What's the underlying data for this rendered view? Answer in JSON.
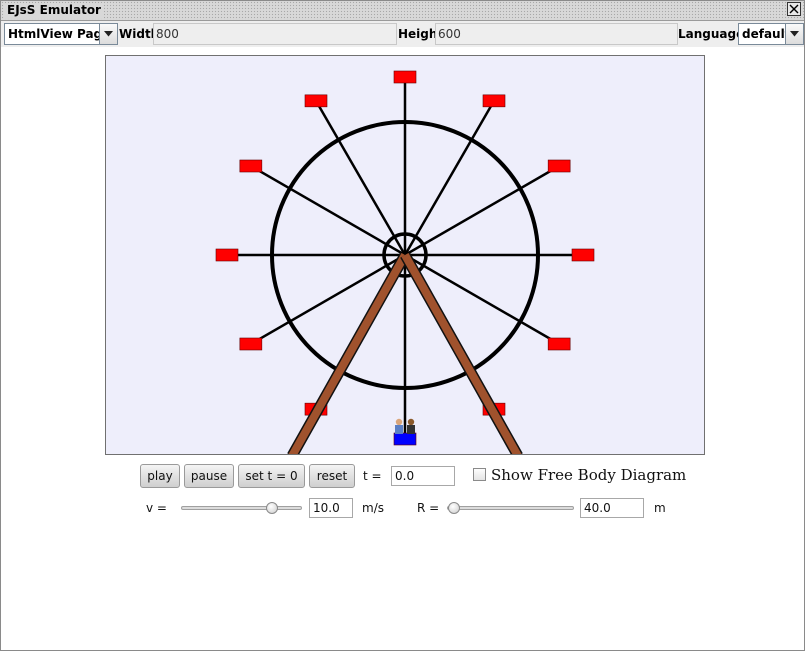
{
  "window": {
    "title": "EJsS Emulator"
  },
  "toolbar": {
    "view_select": "HtmlView Page",
    "width_label": "Width",
    "width_value": "800",
    "height_label": "Height",
    "height_value": "600",
    "language_label": "Language:",
    "language_value": "default"
  },
  "controls": {
    "play_label": "play",
    "pause_label": "pause",
    "set_t0_label": "set t = 0",
    "reset_label": "reset",
    "t_label": "t =",
    "t_value": "0.0",
    "fbd_label": "Show Free Body Diagram",
    "fbd_checked": false,
    "v_label": "v =",
    "v_value": "10.0",
    "v_unit": "m/s",
    "v_slider_fraction": 0.75,
    "r_label": "R =",
    "r_value": "40.0",
    "r_unit": "m",
    "r_slider_fraction": 0.0
  },
  "simulation": {
    "car_count": 12,
    "colors": {
      "wheel": "#000000",
      "spokes": "#000000",
      "car": "#ff0000",
      "rider_car": "#0000ff",
      "support": "#a0522d",
      "background": "#eeeefb"
    }
  }
}
